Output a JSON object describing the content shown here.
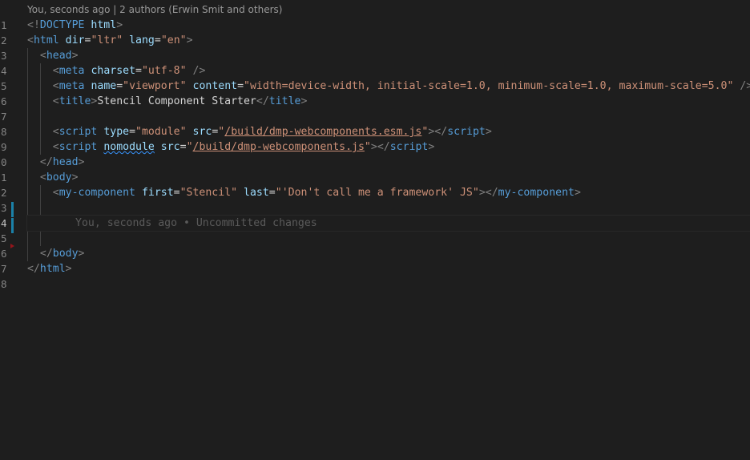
{
  "codelens": "You, seconds ago | 2 authors (Erwin Smit and others)",
  "line_numbers": [
    "1",
    "2",
    "3",
    "4",
    "5",
    "6",
    "7",
    "8",
    "9",
    "0",
    "1",
    "2",
    "3",
    "4",
    "5",
    "6",
    "7",
    "8"
  ],
  "active_line_label": "4",
  "inline_blame": "You, seconds ago • Uncommitted changes",
  "code": {
    "l1": {
      "punc_open": "<!",
      "doctype": "DOCTYPE",
      "html_kw": "html",
      "punc_close": ">"
    },
    "l2": {
      "lt": "<",
      "tag": "html",
      "attr1": "dir",
      "eq1": "=",
      "val1": "\"ltr\"",
      "attr2": "lang",
      "eq2": "=",
      "val2": "\"en\"",
      "gt": ">"
    },
    "l3": {
      "lt": "<",
      "tag": "head",
      "gt": ">"
    },
    "l4": {
      "lt": "<",
      "tag": "meta",
      "attr": "charset",
      "eq": "=",
      "val": "\"utf-8\"",
      "close": "/>"
    },
    "l5": {
      "lt": "<",
      "tag": "meta",
      "attr1": "name",
      "eq1": "=",
      "val1": "\"viewport\"",
      "attr2": "content",
      "eq2": "=",
      "val2": "\"width=device-width, initial-scale=1.0, minimum-scale=1.0, maximum-scale=5.0\"",
      "close": "/>"
    },
    "l6": {
      "lt": "<",
      "tag": "title",
      "gt": ">",
      "text": "Stencil Component Starter",
      "lt2": "</",
      "tag2": "title",
      "gt2": ">"
    },
    "l8": {
      "lt": "<",
      "tag": "script",
      "attr1": "type",
      "eq1": "=",
      "val1": "\"module\"",
      "attr2": "src",
      "eq2": "=",
      "q_open": "\"",
      "link": "/build/dmp-webcomponents.esm.js",
      "q_close": "\"",
      "gt": ">",
      "lt2": "</",
      "tag2": "script",
      "gt2": ">"
    },
    "l9": {
      "lt": "<",
      "tag": "script",
      "attr1": "nomodule",
      "attr2": "src",
      "eq2": "=",
      "q_open": "\"",
      "link": "/build/dmp-webcomponents.js",
      "q_close": "\"",
      "gt": ">",
      "lt2": "</",
      "tag2": "script",
      "gt2": ">"
    },
    "l10": {
      "lt": "</",
      "tag": "head",
      "gt": ">"
    },
    "l11": {
      "lt": "<",
      "tag": "body",
      "gt": ">"
    },
    "l12": {
      "lt": "<",
      "tag": "my-component",
      "attr1": "first",
      "eq1": "=",
      "val1": "\"Stencil\"",
      "attr2": "last",
      "eq2": "=",
      "val2": "\"'Don't call me a framework' JS\"",
      "gt": ">",
      "lt2": "</",
      "tag2": "my-component",
      "gt2": ">"
    },
    "l16": {
      "lt": "</",
      "tag": "body",
      "gt": ">"
    },
    "l17": {
      "lt": "</",
      "tag": "html",
      "gt": ">"
    }
  },
  "colors": {
    "background": "#1e1e1e",
    "tag": "#569cd6",
    "attribute": "#9cdcfe",
    "string": "#ce9178",
    "punctuation": "#808080",
    "text": "#d4d4d4",
    "line_number": "#858585",
    "diff_modified": "#1b81a8"
  }
}
